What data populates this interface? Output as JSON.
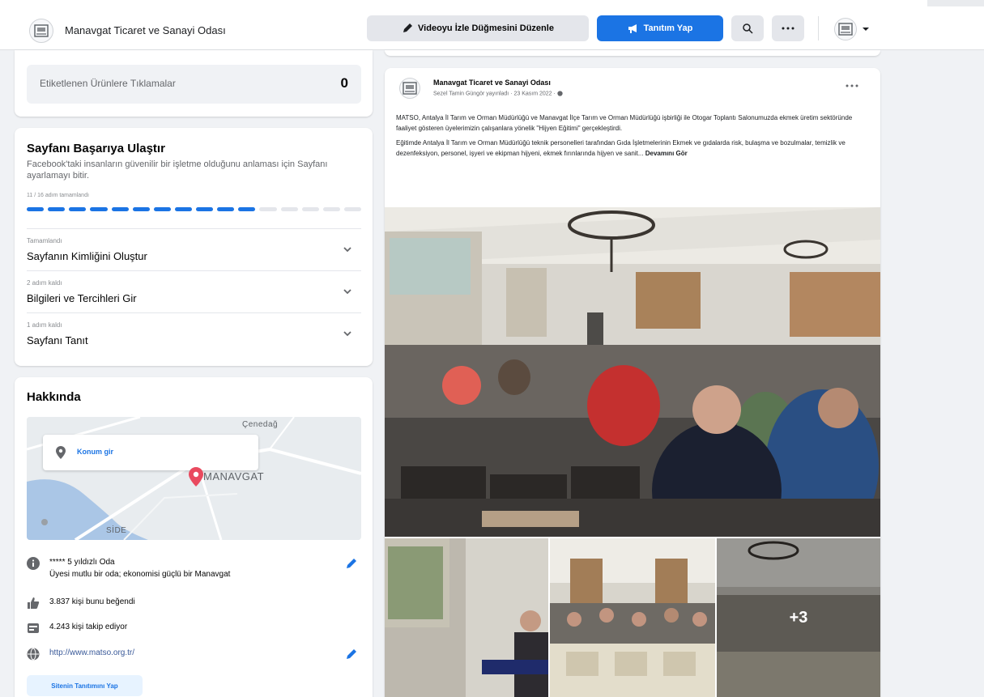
{
  "topbar": {
    "page_name": "Manavgat Ticaret ve Sanayi Odası",
    "edit_video_button": "Videoyu İzle Düğmesini Düzenle",
    "promote_button": "Tanıtım Yap"
  },
  "tagged_products": {
    "label": "Etiketlenen Ürünlere Tıklamalar",
    "count": "0"
  },
  "success": {
    "title": "Sayfanı Başarıya Ulaştır",
    "description": "Facebook'taki insanların güvenilir bir işletme olduğunu anlaması için Sayfanı ayarlamayı bitir.",
    "progress_text": "11 / 16 adım tamamlandı",
    "progress": {
      "completed": 11,
      "total": 16
    },
    "steps": [
      {
        "status": "Tamamlandı",
        "label": "Sayfanın Kimliğini Oluştur"
      },
      {
        "status": "2 adım kaldı",
        "label": "Bilgileri ve Tercihleri Gir"
      },
      {
        "status": "1 adım kaldı",
        "label": "Sayfanı Tanıt"
      }
    ]
  },
  "about": {
    "title": "Hakkında",
    "map_chip": "Konum gir",
    "map_labels": [
      "MANAVGAT",
      "SİDE",
      "Çenedağ"
    ],
    "rows": [
      {
        "line1": "***** 5 yıldızlı Oda",
        "line2": "Üyesi mutlu bir oda; ekonomisi güçlü bir Manavgat"
      },
      {
        "line1": "3.837 kişi bunu beğendi"
      },
      {
        "line1": "4.243 kişi takip ediyor"
      },
      {
        "line1": "http://www.matso.org.tr/"
      }
    ],
    "site_button": "Sitenin Tanıtımını Yap"
  },
  "post": {
    "author": "Manavgat Ticaret ve Sanayi Odası",
    "meta": "Sezel Tamin Güngör yayınladı · 23 Kasım 2022 ·",
    "paragraph1": "MATSO, Antalya İl Tarım ve Orman Müdürlüğü ve Manavgat İlçe Tarım ve Orman Müdürlüğü işbirliği ile Otogar Toplantı Salonumuzda ekmek üretim sektöründe faaliyet gösteren üyelerimizin çalışanlara yönelik \"Hijyen Eğitimi\" gerçekleştirdi.",
    "paragraph2": "Eğitimde Antalya İl Tarım ve Orman Müdürlüğü teknik personelleri tarafından Gıda İşletmelerinin Ekmek ve gıdalarda risk, bulaşma ve bozulmalar, temizlik ve dezenfeksiyon, personel, işyeri ve ekipman hijyeni, ekmek fırınlarında hijyen ve sanit...",
    "see_more": "Devamını Gör",
    "more_photos": "+3"
  },
  "colors": {
    "accent": "#1b74e4",
    "background": "#f0f2f5",
    "progress_empty": "#e4e6eb"
  }
}
